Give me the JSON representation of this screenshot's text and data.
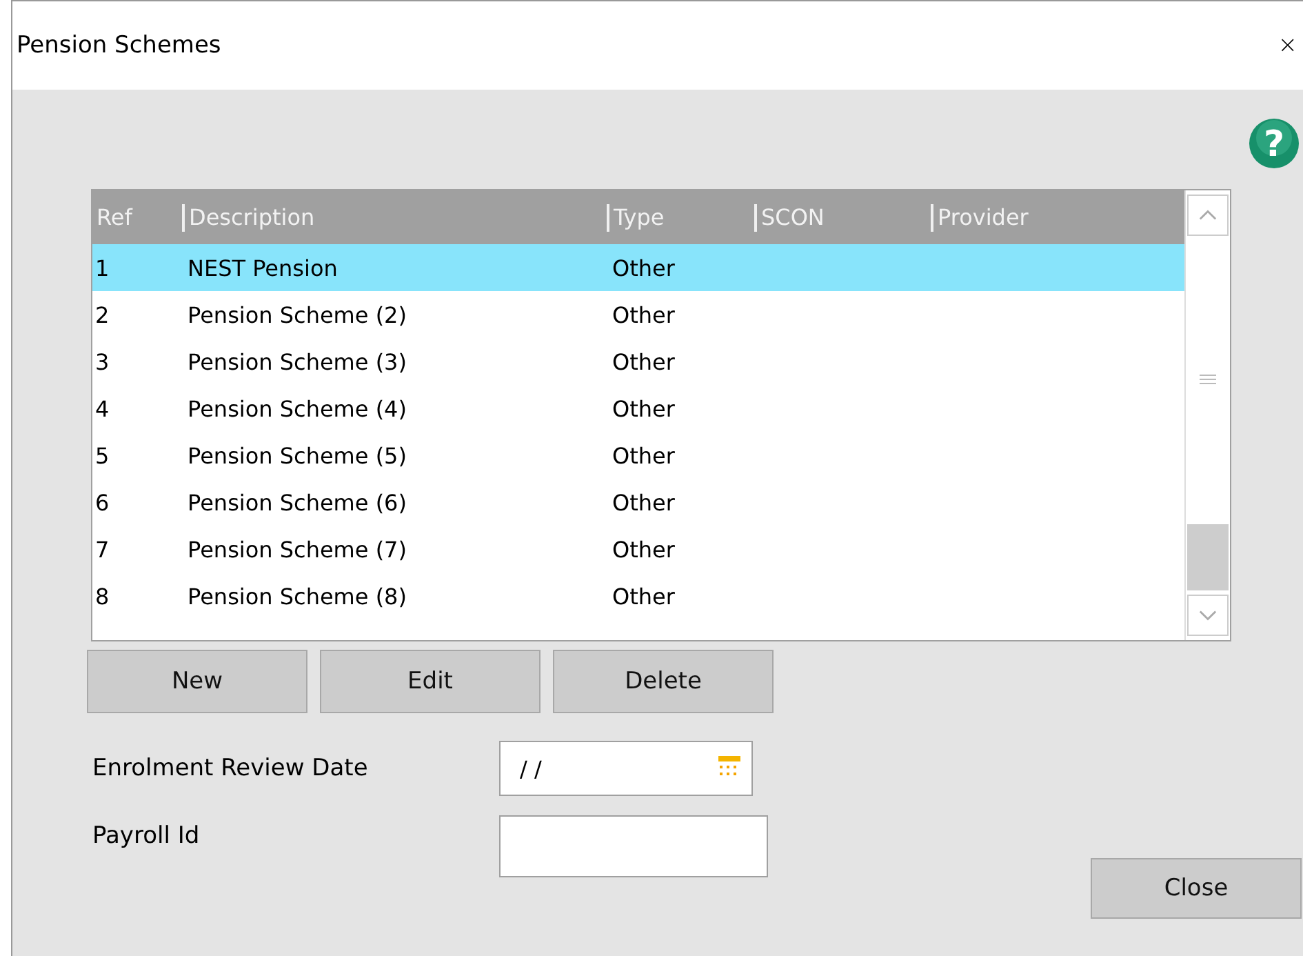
{
  "window": {
    "title": "Pension Schemes",
    "close": "×",
    "help": "?"
  },
  "table": {
    "columns": [
      "Ref",
      "Description",
      "Type",
      "SCON",
      "Provider"
    ],
    "rows": [
      {
        "cells": [
          "1",
          "NEST Pension",
          "Other",
          "",
          ""
        ],
        "selected": true
      },
      {
        "cells": [
          "2",
          "Pension Scheme (2)",
          "Other",
          "",
          ""
        ],
        "selected": false
      },
      {
        "cells": [
          "3",
          "Pension Scheme (3)",
          "Other",
          "",
          ""
        ],
        "selected": false
      },
      {
        "cells": [
          "4",
          "Pension Scheme (4)",
          "Other",
          "",
          ""
        ],
        "selected": false
      },
      {
        "cells": [
          "5",
          "Pension Scheme (5)",
          "Other",
          "",
          ""
        ],
        "selected": false
      },
      {
        "cells": [
          "6",
          "Pension Scheme (6)",
          "Other",
          "",
          ""
        ],
        "selected": false
      },
      {
        "cells": [
          "7",
          "Pension Scheme (7)",
          "Other",
          "",
          ""
        ],
        "selected": false
      },
      {
        "cells": [
          "8",
          "Pension Scheme (8)",
          "Other",
          "",
          ""
        ],
        "selected": false
      }
    ]
  },
  "buttons": [
    "New",
    "Edit",
    "Delete"
  ],
  "fields": [
    {
      "label": "Enrolment Review Date",
      "value": "/ /",
      "kind": "date"
    },
    {
      "label": "Payroll Id",
      "kind": "text"
    }
  ],
  "close_button": "Close"
}
